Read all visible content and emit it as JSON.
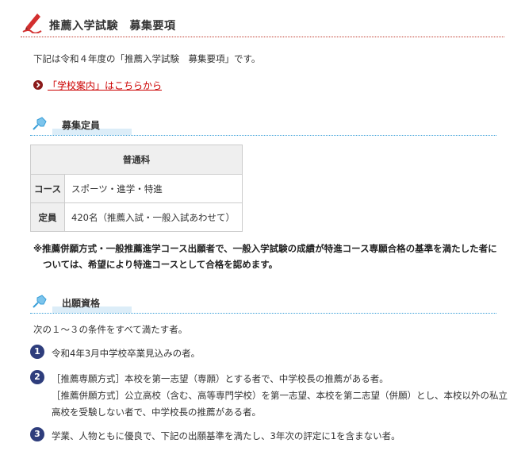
{
  "header": {
    "title": "推薦入学試験　募集要項",
    "icon": "pen-icon"
  },
  "intro": "下記は令和４年度の「推薦入学試験　募集要項」です。",
  "school_link": {
    "label": "「学校案内」はこちらから",
    "icon": "circle-chevron-icon",
    "color": "#cc0000"
  },
  "capacity_section": {
    "title": "募集定員",
    "icon": "pushpin-icon",
    "table": {
      "department": "普通科",
      "rows": [
        {
          "label": "コース",
          "value": "スポーツ・進学・特進"
        },
        {
          "label": "定員",
          "value": "420名（推薦入試・一般入試あわせて）"
        }
      ]
    },
    "note": {
      "line1": "※推薦併願方式・一般推薦進学コース出願者で、一般入学試験の成績が特進コース専願合格の基準を満たした者に",
      "line2": "ついては、希望により特進コースとして合格を認めます。"
    }
  },
  "eligibility_section": {
    "title": "出願資格",
    "icon": "pushpin-icon",
    "intro": "次の１～３の条件をすべて満たす者。",
    "conditions": [
      {
        "number": "1",
        "lines": [
          "令和4年3月中学校卒業見込みの者。"
        ]
      },
      {
        "number": "2",
        "lines": [
          "［推薦専願方式］本校を第一志望（専願）とする者で、中学校長の推薦がある者。",
          "［推薦併願方式］公立高校（含む、高等専門学校）を第一志望、本校を第二志望（併願）とし、本校以外の私立",
          "高校を受験しない者で、中学校長の推薦がある者。"
        ]
      },
      {
        "number": "3",
        "lines": [
          "学業、人物ともに優良で、下記の出願基準を満たし、3年次の評定に1を含まない者。"
        ]
      }
    ],
    "badge_color": "#2e3d7c"
  },
  "colors": {
    "header_rule": "#c0392b",
    "section_rule": "#3a9fd8",
    "table_head_bg": "#efefef"
  }
}
